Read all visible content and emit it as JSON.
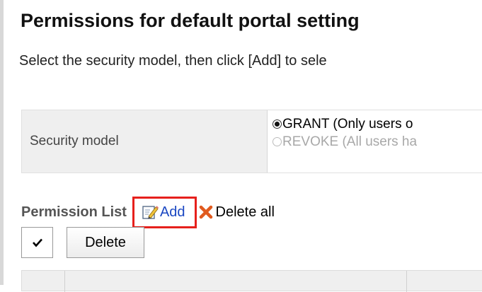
{
  "page": {
    "title": "Permissions for default portal setting",
    "description": "Select the security model, then click [Add] to sele"
  },
  "security": {
    "label": "Security model",
    "options": [
      {
        "label": "GRANT (Only users o",
        "selected": true
      },
      {
        "label": "REVOKE (All users ha",
        "selected": false
      }
    ]
  },
  "permission_list": {
    "title": "Permission List",
    "add_label": "Add",
    "delete_all_label": "Delete all",
    "delete_button_label": "Delete"
  },
  "colors": {
    "highlight_border": "#e6201c",
    "link": "#1a47c2",
    "label_background": "#efefef"
  },
  "icons": [
    "edit-icon",
    "delete-x-icon",
    "checkmark-icon"
  ]
}
